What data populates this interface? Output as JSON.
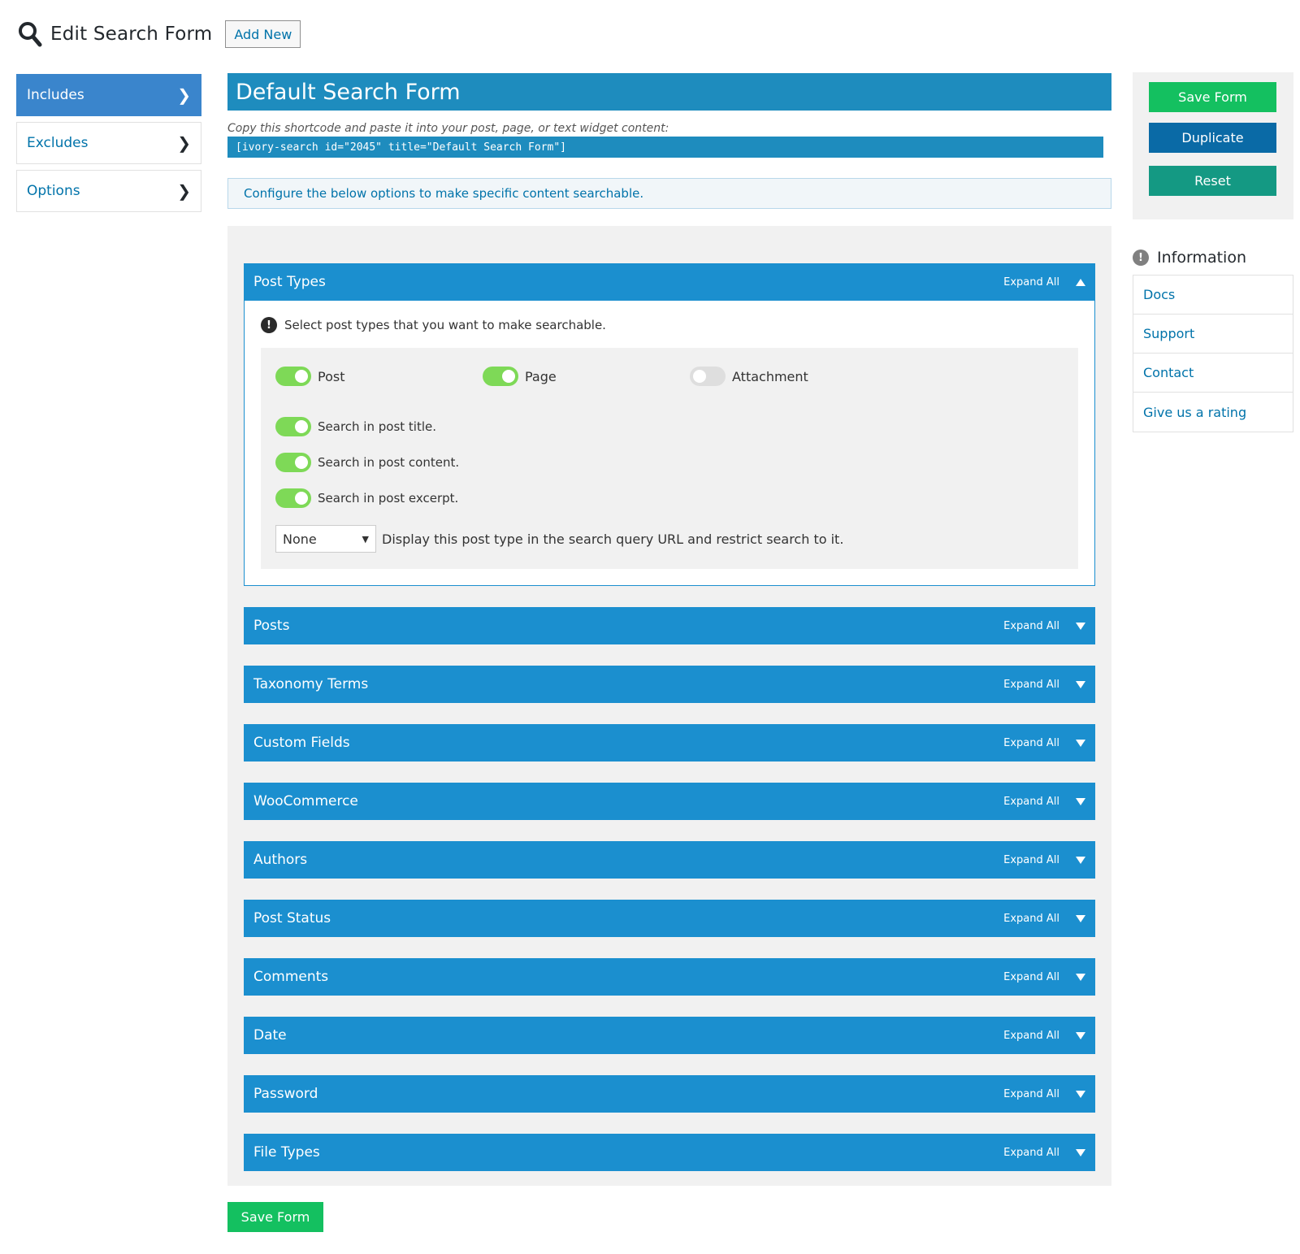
{
  "header": {
    "title": "Edit Search Form",
    "add_new_label": "Add New"
  },
  "left_nav": {
    "items": [
      {
        "label": "Includes",
        "active": true
      },
      {
        "label": "Excludes",
        "active": false
      },
      {
        "label": "Options",
        "active": false
      }
    ]
  },
  "main": {
    "form_title": "Default Search Form",
    "shortcode_hint": "Copy this shortcode and paste it into your post, page, or text widget content:",
    "shortcode": "[ivory-search id=\"2045\" title=\"Default Search Form\"]",
    "notice": "Configure the below options to make specific content searchable."
  },
  "post_types_panel": {
    "title": "Post Types",
    "expand_label": "Expand All",
    "hint": "Select post types that you want to make searchable.",
    "types": [
      {
        "label": "Post",
        "enabled": true
      },
      {
        "label": "Page",
        "enabled": true
      },
      {
        "label": "Attachment",
        "enabled": false
      }
    ],
    "options": [
      {
        "label": "Search in post title.",
        "enabled": true
      },
      {
        "label": "Search in post content.",
        "enabled": true
      },
      {
        "label": "Search in post excerpt.",
        "enabled": true
      }
    ],
    "select_value": "None",
    "select_desc": "Display this post type in the search query URL and restrict search to it."
  },
  "collapsed_panels": [
    {
      "title": "Posts",
      "expand_label": "Expand All"
    },
    {
      "title": "Taxonomy Terms",
      "expand_label": "Expand All"
    },
    {
      "title": "Custom Fields",
      "expand_label": "Expand All"
    },
    {
      "title": "WooCommerce",
      "expand_label": "Expand All"
    },
    {
      "title": "Authors",
      "expand_label": "Expand All"
    },
    {
      "title": "Post Status",
      "expand_label": "Expand All"
    },
    {
      "title": "Comments",
      "expand_label": "Expand All"
    },
    {
      "title": "Date",
      "expand_label": "Expand All"
    },
    {
      "title": "Password",
      "expand_label": "Expand All"
    },
    {
      "title": "File Types",
      "expand_label": "Expand All"
    }
  ],
  "bottom": {
    "save_label": "Save Form"
  },
  "sidebar": {
    "save_label": "Save Form",
    "duplicate_label": "Duplicate",
    "reset_label": "Reset",
    "info_title": "Information",
    "info_links": [
      "Docs",
      "Support",
      "Contact",
      "Give us a rating"
    ]
  },
  "colors": {
    "accent_blue": "#1b8fcf",
    "nav_active": "#3a85cc",
    "save_green": "#14c060",
    "duplicate_blue": "#0a6aa6",
    "reset_teal": "#149983",
    "toggle_on": "#7ed957",
    "link": "#0073aa"
  },
  "icons": {
    "header": "search-icon",
    "nav_chevron": "chevron-right-icon",
    "info": "info-icon"
  }
}
